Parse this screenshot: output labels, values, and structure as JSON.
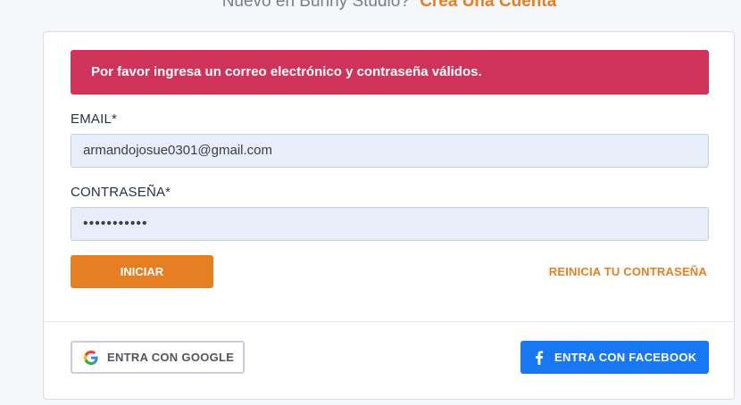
{
  "header": {
    "prompt": "Nuevo en Bunny Studio?",
    "create_account_link": "Crea Una Cuenta"
  },
  "alert": {
    "message": "Por favor ingresa un correo electrónico y contraseña válidos."
  },
  "form": {
    "email_label": "EMAIL*",
    "email_value": "armandojosue0301@gmail.com",
    "password_label": "CONTRASEÑA*",
    "password_value": "•••••••••••",
    "login_button": "INICIAR",
    "reset_link": "REINICIA TU CONTRASEÑA"
  },
  "social": {
    "google_button": "ENTRA CON GOOGLE",
    "facebook_button": "ENTRA CON FACEBOOK"
  },
  "colors": {
    "accent": "#e67e22",
    "alert": "#d0335a",
    "facebook": "#1877f2"
  },
  "icons": {
    "google": "google-icon",
    "facebook": "facebook-icon"
  }
}
